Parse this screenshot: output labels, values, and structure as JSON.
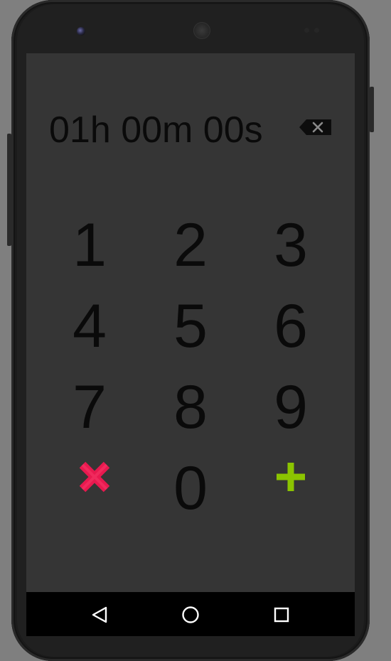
{
  "timer": {
    "display": "01h 00m 00s"
  },
  "keypad": {
    "digits": [
      "1",
      "2",
      "3",
      "4",
      "5",
      "6",
      "7",
      "8",
      "9",
      "0"
    ]
  },
  "icons": {
    "backspace": "backspace-icon",
    "cancel": "cancel-x-icon",
    "add": "add-plus-icon",
    "nav_back": "back-triangle-icon",
    "nav_home": "home-circle-icon",
    "nav_recents": "recents-square-icon"
  },
  "colors": {
    "screen_background": "#353535",
    "cancel_accent": "#e8194f",
    "add_accent": "#8bc400",
    "digit_text": "#0a0a0a",
    "navbar": "#000000"
  }
}
